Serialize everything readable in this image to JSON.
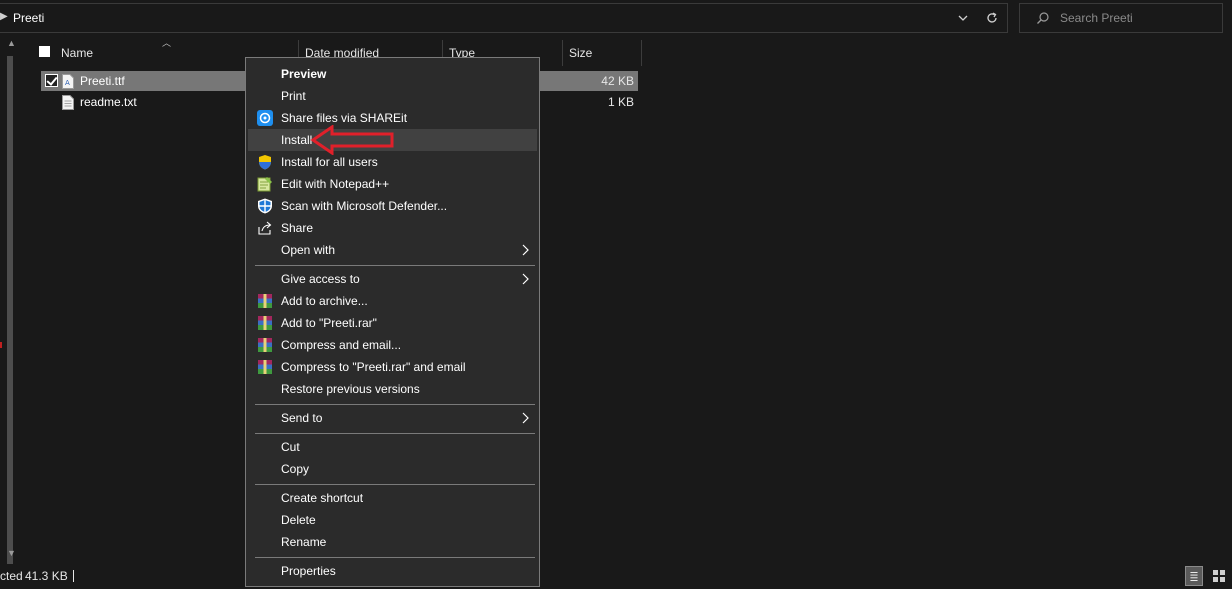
{
  "address": {
    "path": "Preeti",
    "search_placeholder": "Search Preeti"
  },
  "columns": {
    "name": "Name",
    "date_modified": "Date modified",
    "type": "Type",
    "size": "Size"
  },
  "files": [
    {
      "name": "Preeti.ttf",
      "size": "42 KB",
      "selected": true,
      "icon": "font-file-icon"
    },
    {
      "name": "readme.txt",
      "size": "1 KB",
      "selected": false,
      "icon": "text-file-icon"
    }
  ],
  "status": {
    "selected_text": "cted",
    "size_text": "41.3 KB"
  },
  "context_menu": {
    "items": [
      {
        "label": "Preview",
        "bold": true
      },
      {
        "label": "Print"
      },
      {
        "label": "Share files via SHAREit",
        "icon": "shareit-icon"
      },
      {
        "label": "Install",
        "highlighted": true
      },
      {
        "label": "Install for all users",
        "icon": "uac-shield-icon"
      },
      {
        "label": "Edit with Notepad++",
        "icon": "notepad-plus-plus-icon"
      },
      {
        "label": "Scan with Microsoft Defender...",
        "icon": "defender-icon"
      },
      {
        "label": "Share",
        "icon": "share-icon"
      },
      {
        "label": "Open with",
        "submenu": true
      },
      {
        "label": "Give access to",
        "submenu": true
      },
      {
        "label": "Add to archive...",
        "icon": "winrar-icon"
      },
      {
        "label": "Add to \"Preeti.rar\"",
        "icon": "winrar-icon"
      },
      {
        "label": "Compress and email...",
        "icon": "winrar-icon"
      },
      {
        "label": "Compress to \"Preeti.rar\" and email",
        "icon": "winrar-icon"
      },
      {
        "label": "Restore previous versions"
      },
      {
        "label": "Send to",
        "submenu": true
      },
      {
        "label": "Cut"
      },
      {
        "label": "Copy"
      },
      {
        "label": "Create shortcut"
      },
      {
        "label": "Delete"
      },
      {
        "label": "Rename"
      },
      {
        "label": "Properties"
      }
    ]
  },
  "colors": {
    "background": "#191919",
    "menu_background": "#2b2b2b",
    "menu_hover": "#414141",
    "selected_row": "#777777",
    "annotation_arrow": "#e0202a"
  }
}
